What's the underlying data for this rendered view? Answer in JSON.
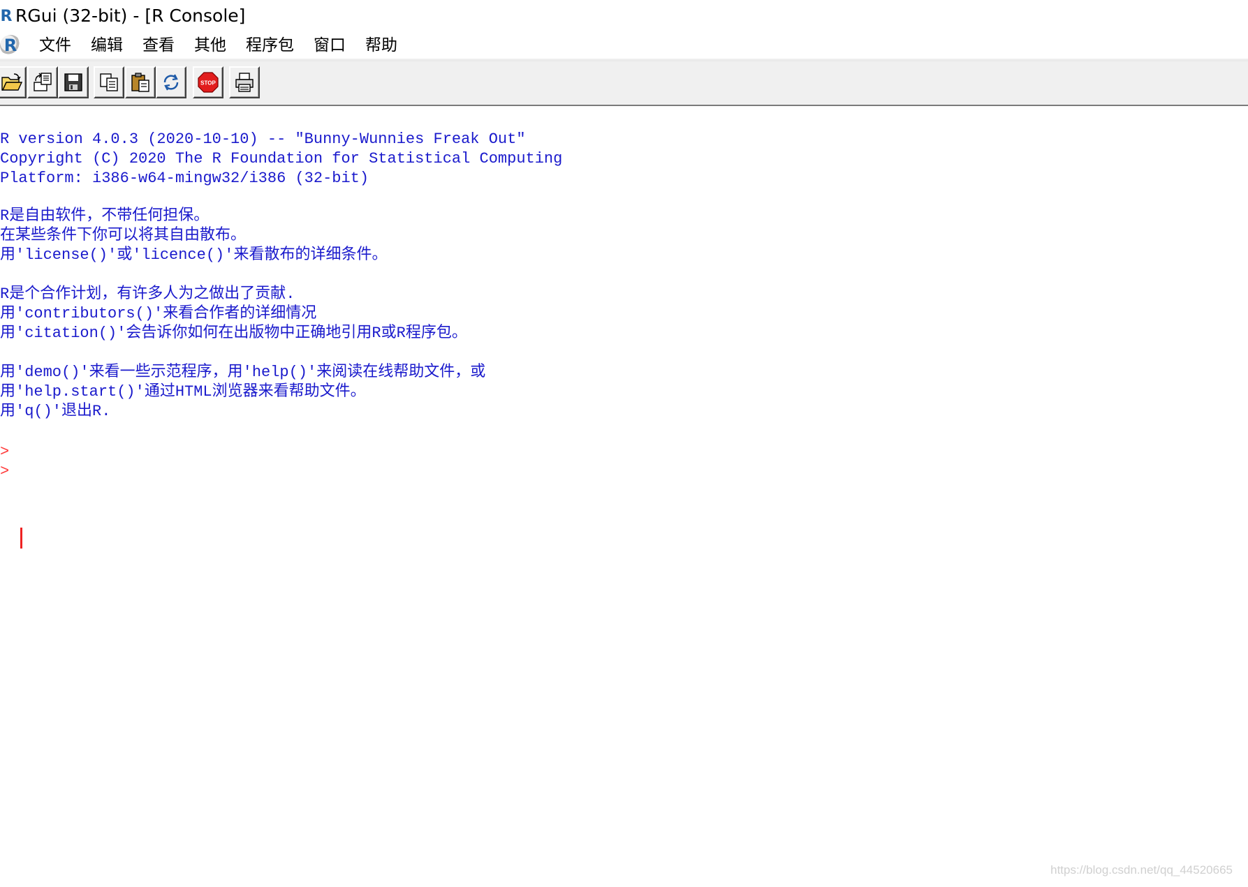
{
  "window": {
    "title": "RGui (32-bit) - [R Console]",
    "logo_glyph": "R"
  },
  "menubar": {
    "items": [
      {
        "label": "文件"
      },
      {
        "label": "编辑"
      },
      {
        "label": "查看"
      },
      {
        "label": "其他"
      },
      {
        "label": "程序包"
      },
      {
        "label": "窗口"
      },
      {
        "label": "帮助"
      }
    ]
  },
  "toolbar": {
    "buttons": [
      {
        "icon": "open-folder-icon"
      },
      {
        "icon": "load-workspace-icon"
      },
      {
        "icon": "save-icon"
      },
      {
        "icon": "copy-icon"
      },
      {
        "icon": "paste-icon"
      },
      {
        "icon": "refresh-icon"
      },
      {
        "icon": "stop-icon",
        "label": "STOP"
      },
      {
        "icon": "print-icon"
      }
    ]
  },
  "console": {
    "lines": [
      "R version 4.0.3 (2020-10-10) -- \"Bunny-Wunnies Freak Out\"",
      "Copyright (C) 2020 The R Foundation for Statistical Computing",
      "Platform: i386-w64-mingw32/i386 (32-bit)",
      "R是自由软件，不带任何担保。",
      "在某些条件下你可以将其自由散布。",
      "用'license()'或'licence()'来看散布的详细条件。",
      "R是个合作计划，有许多人为之做出了贡献.",
      "用'contributors()'来看合作者的详细情况",
      "用'citation()'会告诉你如何在出版物中正确地引用R或R程序包。",
      "用'demo()'来看一些示范程序，用'help()'来阅读在线帮助文件，或",
      "用'help.start()'通过HTML浏览器来看帮助文件。",
      "用'q()'退出R."
    ],
    "prompt": ">",
    "text_color": "#1a1acc",
    "prompt_color": "#ff3b3b"
  },
  "watermark": "https://blog.csdn.net/qq_44520665"
}
